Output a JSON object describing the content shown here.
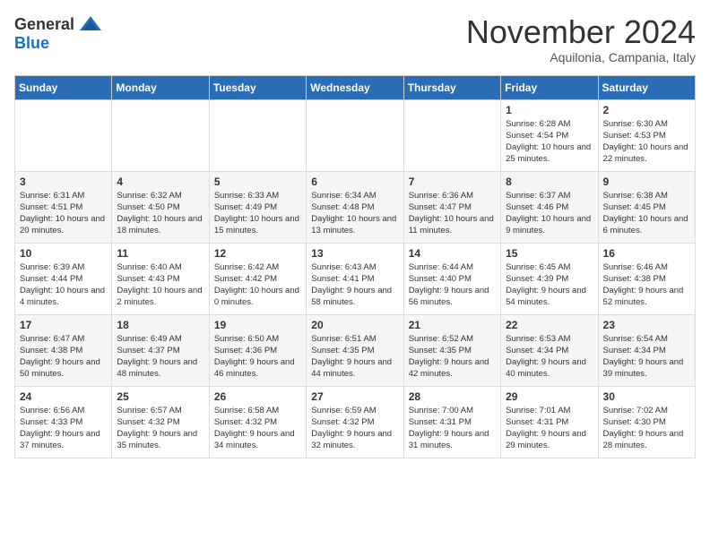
{
  "header": {
    "logo_general": "General",
    "logo_blue": "Blue",
    "month_title": "November 2024",
    "location": "Aquilonia, Campania, Italy"
  },
  "calendar": {
    "days_of_week": [
      "Sunday",
      "Monday",
      "Tuesday",
      "Wednesday",
      "Thursday",
      "Friday",
      "Saturday"
    ],
    "weeks": [
      [
        {
          "day": "",
          "info": ""
        },
        {
          "day": "",
          "info": ""
        },
        {
          "day": "",
          "info": ""
        },
        {
          "day": "",
          "info": ""
        },
        {
          "day": "",
          "info": ""
        },
        {
          "day": "1",
          "info": "Sunrise: 6:28 AM\nSunset: 4:54 PM\nDaylight: 10 hours and 25 minutes."
        },
        {
          "day": "2",
          "info": "Sunrise: 6:30 AM\nSunset: 4:53 PM\nDaylight: 10 hours and 22 minutes."
        }
      ],
      [
        {
          "day": "3",
          "info": "Sunrise: 6:31 AM\nSunset: 4:51 PM\nDaylight: 10 hours and 20 minutes."
        },
        {
          "day": "4",
          "info": "Sunrise: 6:32 AM\nSunset: 4:50 PM\nDaylight: 10 hours and 18 minutes."
        },
        {
          "day": "5",
          "info": "Sunrise: 6:33 AM\nSunset: 4:49 PM\nDaylight: 10 hours and 15 minutes."
        },
        {
          "day": "6",
          "info": "Sunrise: 6:34 AM\nSunset: 4:48 PM\nDaylight: 10 hours and 13 minutes."
        },
        {
          "day": "7",
          "info": "Sunrise: 6:36 AM\nSunset: 4:47 PM\nDaylight: 10 hours and 11 minutes."
        },
        {
          "day": "8",
          "info": "Sunrise: 6:37 AM\nSunset: 4:46 PM\nDaylight: 10 hours and 9 minutes."
        },
        {
          "day": "9",
          "info": "Sunrise: 6:38 AM\nSunset: 4:45 PM\nDaylight: 10 hours and 6 minutes."
        }
      ],
      [
        {
          "day": "10",
          "info": "Sunrise: 6:39 AM\nSunset: 4:44 PM\nDaylight: 10 hours and 4 minutes."
        },
        {
          "day": "11",
          "info": "Sunrise: 6:40 AM\nSunset: 4:43 PM\nDaylight: 10 hours and 2 minutes."
        },
        {
          "day": "12",
          "info": "Sunrise: 6:42 AM\nSunset: 4:42 PM\nDaylight: 10 hours and 0 minutes."
        },
        {
          "day": "13",
          "info": "Sunrise: 6:43 AM\nSunset: 4:41 PM\nDaylight: 9 hours and 58 minutes."
        },
        {
          "day": "14",
          "info": "Sunrise: 6:44 AM\nSunset: 4:40 PM\nDaylight: 9 hours and 56 minutes."
        },
        {
          "day": "15",
          "info": "Sunrise: 6:45 AM\nSunset: 4:39 PM\nDaylight: 9 hours and 54 minutes."
        },
        {
          "day": "16",
          "info": "Sunrise: 6:46 AM\nSunset: 4:38 PM\nDaylight: 9 hours and 52 minutes."
        }
      ],
      [
        {
          "day": "17",
          "info": "Sunrise: 6:47 AM\nSunset: 4:38 PM\nDaylight: 9 hours and 50 minutes."
        },
        {
          "day": "18",
          "info": "Sunrise: 6:49 AM\nSunset: 4:37 PM\nDaylight: 9 hours and 48 minutes."
        },
        {
          "day": "19",
          "info": "Sunrise: 6:50 AM\nSunset: 4:36 PM\nDaylight: 9 hours and 46 minutes."
        },
        {
          "day": "20",
          "info": "Sunrise: 6:51 AM\nSunset: 4:35 PM\nDaylight: 9 hours and 44 minutes."
        },
        {
          "day": "21",
          "info": "Sunrise: 6:52 AM\nSunset: 4:35 PM\nDaylight: 9 hours and 42 minutes."
        },
        {
          "day": "22",
          "info": "Sunrise: 6:53 AM\nSunset: 4:34 PM\nDaylight: 9 hours and 40 minutes."
        },
        {
          "day": "23",
          "info": "Sunrise: 6:54 AM\nSunset: 4:34 PM\nDaylight: 9 hours and 39 minutes."
        }
      ],
      [
        {
          "day": "24",
          "info": "Sunrise: 6:56 AM\nSunset: 4:33 PM\nDaylight: 9 hours and 37 minutes."
        },
        {
          "day": "25",
          "info": "Sunrise: 6:57 AM\nSunset: 4:32 PM\nDaylight: 9 hours and 35 minutes."
        },
        {
          "day": "26",
          "info": "Sunrise: 6:58 AM\nSunset: 4:32 PM\nDaylight: 9 hours and 34 minutes."
        },
        {
          "day": "27",
          "info": "Sunrise: 6:59 AM\nSunset: 4:32 PM\nDaylight: 9 hours and 32 minutes."
        },
        {
          "day": "28",
          "info": "Sunrise: 7:00 AM\nSunset: 4:31 PM\nDaylight: 9 hours and 31 minutes."
        },
        {
          "day": "29",
          "info": "Sunrise: 7:01 AM\nSunset: 4:31 PM\nDaylight: 9 hours and 29 minutes."
        },
        {
          "day": "30",
          "info": "Sunrise: 7:02 AM\nSunset: 4:30 PM\nDaylight: 9 hours and 28 minutes."
        }
      ]
    ]
  }
}
